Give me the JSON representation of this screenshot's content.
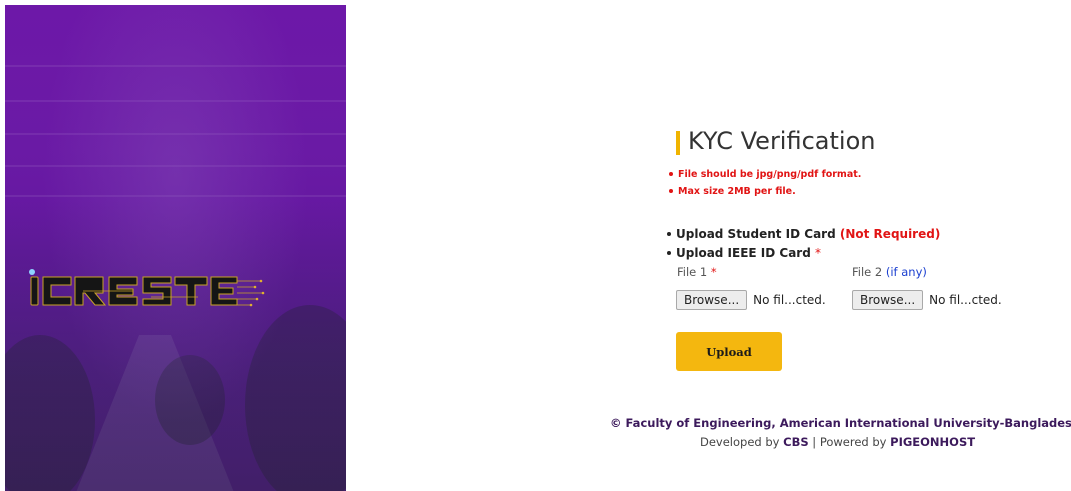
{
  "branding": {
    "logo_text": "ICREST"
  },
  "kyc": {
    "title": "KYC Verification",
    "rules": [
      "File should be jpg/png/pdf format.",
      "Max size 2MB per file."
    ],
    "items": [
      {
        "label": "Upload Student ID Card",
        "note": "(Not Required)"
      },
      {
        "label": "Upload IEEE ID Card",
        "required_mark": "*"
      }
    ],
    "file1": {
      "label": "File 1",
      "required_mark": "*",
      "button": "Browse...",
      "status": "No fil...cted."
    },
    "file2": {
      "label": "File 2",
      "hint": "(if any)",
      "button": "Browse...",
      "status": "No fil...cted."
    },
    "upload_button": "Upload"
  },
  "footer": {
    "copyright": "© Faculty of Engineering, American International University-Bangladesh.",
    "developed_prefix": "Developed by",
    "developer": "CBS",
    "separator": "|",
    "powered_prefix": "Powered by",
    "host": "PIGEONHOST"
  },
  "colors": {
    "hero_purple": "#6a1aa5",
    "accent_yellow": "#f4b70f",
    "error_red": "#e11414",
    "link_blue": "#1a3fd0",
    "footer_purple": "#3c1a5c"
  }
}
